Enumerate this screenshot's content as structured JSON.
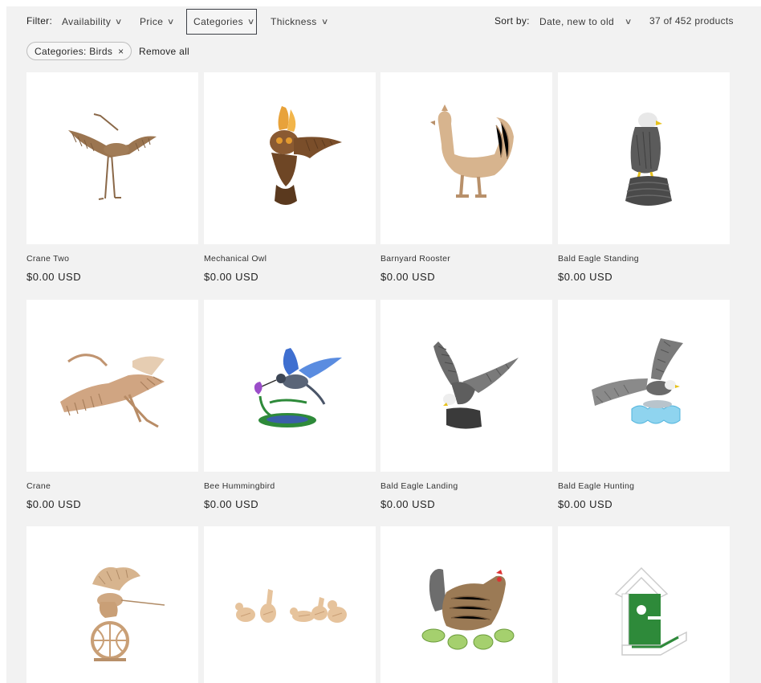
{
  "filter": {
    "label": "Filter:",
    "facets": [
      {
        "label": "Availability",
        "chevron": "chevron-down-icon"
      },
      {
        "label": "Price",
        "chevron": "chevron-down-icon"
      },
      {
        "label": "Categories",
        "chevron": "chevron-down-icon",
        "active": true
      },
      {
        "label": "Thickness",
        "chevron": "chevron-down-icon"
      }
    ]
  },
  "sort": {
    "label": "Sort by:",
    "value": "Date, new to old",
    "chevron": "chevron-down-icon"
  },
  "count": "37 of 452 products",
  "active_filters": {
    "pill": "Categories: Birds",
    "pill_remove": "×",
    "remove_all": "Remove all"
  },
  "products": [
    {
      "name": "Crane Two",
      "price": "$0.00 USD",
      "image": "crane-two-image"
    },
    {
      "name": "Mechanical Owl",
      "price": "$0.00 USD",
      "image": "mechanical-owl-image"
    },
    {
      "name": "Barnyard Rooster",
      "price": "$0.00 USD",
      "image": "barnyard-rooster-image"
    },
    {
      "name": "Bald Eagle Standing",
      "price": "$0.00 USD",
      "image": "bald-eagle-standing-image"
    },
    {
      "name": "Crane",
      "price": "$0.00 USD",
      "image": "crane-image"
    },
    {
      "name": "Bee Hummingbird",
      "price": "$0.00 USD",
      "image": "bee-hummingbird-image"
    },
    {
      "name": "Bald Eagle Landing",
      "price": "$0.00 USD",
      "image": "bald-eagle-landing-image"
    },
    {
      "name": "Bald Eagle Hunting",
      "price": "$0.00 USD",
      "image": "bald-eagle-hunting-image"
    },
    {
      "name": "",
      "price": "",
      "image": "hummingbird-globe-image"
    },
    {
      "name": "",
      "price": "",
      "image": "ducks-image"
    },
    {
      "name": "",
      "price": "",
      "image": "hen-and-chicks-image"
    },
    {
      "name": "",
      "price": "",
      "image": "birdhouse-image"
    }
  ],
  "colors": {
    "page_bg": "#f2f2f2",
    "card_bg": "#ffffff",
    "active_facet_border": "#3c3f46",
    "wood": "#c9a27c",
    "gray_model": "#6b6b6b",
    "blue_model": "#4a78c8",
    "green_model": "#2e8a3a"
  }
}
